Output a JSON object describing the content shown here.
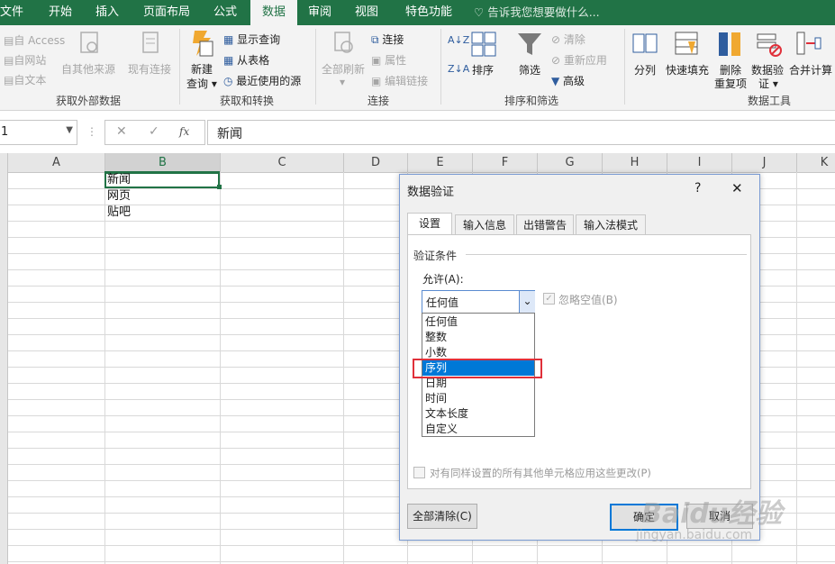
{
  "tabs": [
    "文件",
    "开始",
    "插入",
    "页面布局",
    "公式",
    "数据",
    "审阅",
    "视图",
    "特色功能"
  ],
  "active_tab": "数据",
  "tell_me": "告诉我您想要做什么...",
  "ribbon": {
    "get_external": {
      "access": "自 Access",
      "web": "自网站",
      "text": "自文本",
      "other": "自其他来源",
      "existing": "现有连接",
      "label": "获取外部数据"
    },
    "get_transform": {
      "new_query_1": "新建",
      "new_query_2": "查询",
      "show_queries": "显示查询",
      "from_table": "从表格",
      "recent_sources": "最近使用的源",
      "label": "获取和转换"
    },
    "connections": {
      "refresh_all": "全部刷新",
      "connections": "连接",
      "properties": "属性",
      "edit_links": "编辑链接",
      "label": "连接"
    },
    "sort_filter": {
      "sort": "排序",
      "filter": "筛选",
      "clear": "清除",
      "reapply": "重新应用",
      "advanced": "高级",
      "label": "排序和筛选"
    },
    "data_tools": {
      "text_to_columns": "分列",
      "flash_fill": "快速填充",
      "remove_dup_1": "删除",
      "remove_dup_2": "重复项",
      "validation_1": "数据验",
      "validation_2": "证",
      "consolidate": "合并计算",
      "label": "数据工具"
    }
  },
  "formula_bar": {
    "name_box": "1",
    "fx": "fx",
    "content": "新闻"
  },
  "columns": [
    "A",
    "B",
    "C",
    "D",
    "E",
    "F",
    "G",
    "H",
    "I",
    "J",
    "K"
  ],
  "cells": [
    "新闻",
    "网页",
    "贴吧"
  ],
  "dialog": {
    "title": "数据验证",
    "help": "?",
    "close": "✕",
    "tabs": [
      "设置",
      "输入信息",
      "出错警告",
      "输入法模式"
    ],
    "criteria_label": "验证条件",
    "allow_label": "允许(A):",
    "allow_value": "任何值",
    "ignore_blank": "忽略空值(B)",
    "options": [
      "任何值",
      "整数",
      "小数",
      "序列",
      "日期",
      "时间",
      "文本长度",
      "自定义"
    ],
    "highlighted": "序列",
    "apply_all": "对有同样设置的所有其他单元格应用这些更改(P)",
    "clear_all": "全部清除(C)",
    "ok": "确定",
    "cancel": "取消"
  },
  "watermark": "Baidu经验",
  "watermark_sub": "jingyan.baidu.com",
  "colors": {
    "excel_green": "#217346",
    "selection_blue": "#0078d7",
    "highlight_red": "#e0303a"
  }
}
